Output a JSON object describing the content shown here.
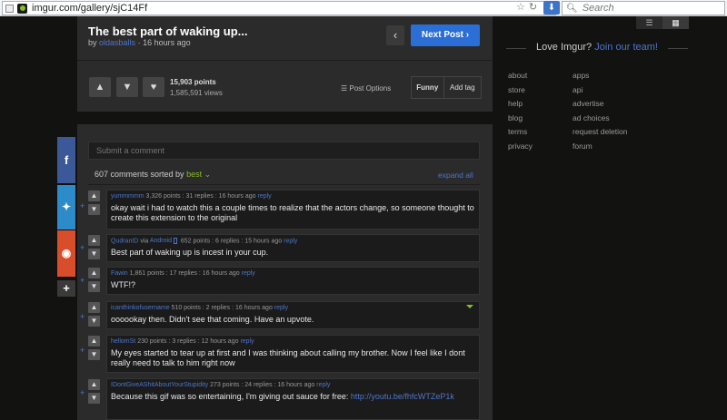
{
  "browser": {
    "url": "imgur.com/gallery/sjC14Ff",
    "star": "☆",
    "reload": "↻",
    "bookmark": "⬇",
    "search_placeholder": "Search"
  },
  "post": {
    "title": "The best part of waking up...",
    "by": "by",
    "author": "oldasballs",
    "time": "· 16 hours ago",
    "next_label": "Next Post ›",
    "prev_symbol": "‹",
    "points": "15,903 points",
    "views": "1,585,591 views",
    "options": "☰ Post Options",
    "tag": "Funny",
    "add_tag": "Add tag"
  },
  "sidebar": {
    "love_text": "Love Imgur?",
    "join_text": "Join our team!",
    "links_left": [
      "about",
      "store",
      "help",
      "blog",
      "terms",
      "privacy"
    ],
    "links_right": [
      "apps",
      "api",
      "advertise",
      "ad choices",
      "request deletion",
      "forum"
    ]
  },
  "comments": {
    "placeholder": "Submit a comment",
    "count": "607 comments sorted by",
    "sort": "best",
    "expand": "expand all",
    "items": [
      {
        "author": "yummmmm",
        "meta": "3,326 points : 31 replies : 16 hours ago",
        "reply": "reply",
        "body": "okay wait i had to watch this a couple times to realize that the actors change, so someone thought to create this extension to the original"
      },
      {
        "author": "QudrantD",
        "via": "via",
        "device": "Android",
        "meta": "652 points : 6 replies : 15 hours ago",
        "reply": "reply",
        "body": "Best part of waking up is incest in your cup."
      },
      {
        "author": "Fawin",
        "meta": "1,861 points : 17 replies : 16 hours ago",
        "reply": "reply",
        "body": "WTF!?"
      },
      {
        "author": "icanthinkofusername",
        "meta": "510 points : 2 replies : 16 hours ago",
        "reply": "reply",
        "body": "oooookay then. Didn't see that coming. Have an upvote."
      },
      {
        "author": "hellomSt",
        "meta": "230 points : 3 replies : 12 hours ago",
        "reply": "reply",
        "body": "My eyes started to tear up at first and I was thinking about calling my brother. Now I feel like I dont really need to talk to him right now"
      },
      {
        "author": "IDontGiveAShitAboutYourStupidity",
        "meta": "273 points : 24 replies : 16 hours ago",
        "reply": "reply",
        "body": "Because this gif was so entertaining, I'm giving out sauce for free: ",
        "link": "http://youtu.be/fhfcWTZeP1k"
      }
    ]
  }
}
